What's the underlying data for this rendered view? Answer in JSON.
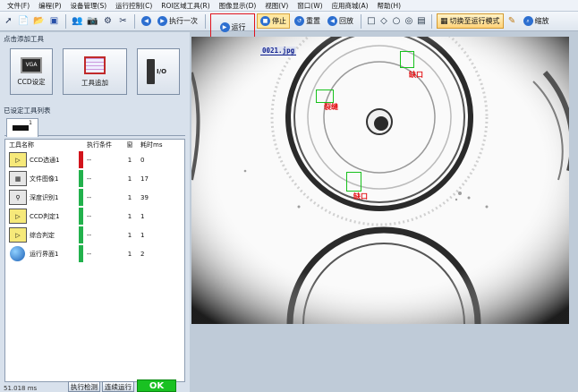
{
  "menu": [
    "文件(F)",
    "编程(P)",
    "设备管理(S)",
    "运行控制(C)",
    "ROI区域工具(R)",
    "图像显示(D)",
    "视图(V)",
    "窗口(W)",
    "应用商城(A)",
    "帮助(H)"
  ],
  "toolbar": {
    "run_once": "执行一次",
    "run": "运行",
    "stop": "停止",
    "reset": "重置",
    "playback": "回放",
    "switch_mode": "切换至运行模式",
    "zoom": "缩放"
  },
  "left_panel": {
    "add_tool_title": "点击添加工具",
    "tool_list_title": "已设定工具列表",
    "ccd_setting": "CCD设定",
    "vga": "VGA",
    "tool_add": "工具追加",
    "io": "I/O",
    "tab_number": "1",
    "columns": [
      "工具名称",
      "执行条件",
      "窗",
      "耗时ms"
    ],
    "rows": [
      {
        "name": "CCD选通1",
        "cond": "--",
        "win": "1",
        "time": "0",
        "status": "#d2141c"
      },
      {
        "name": "文件图像1",
        "cond": "--",
        "win": "1",
        "time": "17",
        "status": "#22b14c"
      },
      {
        "name": "深度识别1",
        "cond": "--",
        "win": "1",
        "time": "39",
        "status": "#22b14c"
      },
      {
        "name": "CCD判定1",
        "cond": "--",
        "win": "1",
        "time": "1",
        "status": "#22b14c"
      },
      {
        "name": "综合判定",
        "cond": "--",
        "win": "1",
        "time": "1",
        "status": "#22b14c"
      },
      {
        "name": "运行界面1",
        "cond": "--",
        "win": "1",
        "time": "2",
        "status": "#22b14c"
      }
    ],
    "status_text": "51.018 ms",
    "btn_exec": "执行检测",
    "btn_continuous": "连续运行",
    "btn_ok": "OK"
  },
  "viewer": {
    "filename": "0021.jpg",
    "defects": [
      {
        "label": "缺口"
      },
      {
        "label": "裂缝"
      },
      {
        "label": "缺口"
      }
    ]
  },
  "colors": {
    "accent_red": "#e30f12",
    "box_green": "#17c11c",
    "ok_green": "#19c122"
  }
}
